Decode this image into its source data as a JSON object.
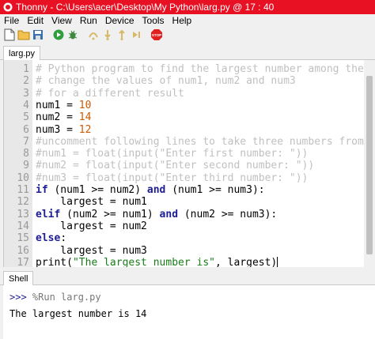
{
  "window": {
    "title": "Thonny  -  C:\\Users\\acer\\Desktop\\My Python\\larg.py  @  17 : 40",
    "accent": "#e81123"
  },
  "menu": [
    "File",
    "Edit",
    "View",
    "Run",
    "Device",
    "Tools",
    "Help"
  ],
  "toolbar": {
    "icons": [
      "new-file-icon",
      "open-file-icon",
      "save-icon",
      "run-icon",
      "debug-icon",
      "step-over-icon",
      "step-into-icon",
      "step-out-icon",
      "resume-icon",
      "stop-icon"
    ],
    "stop_label": "STOP"
  },
  "editor": {
    "tab_label": "larg.py",
    "line_numbers": [
      "1",
      "2",
      "3",
      "4",
      "5",
      "6",
      "7",
      "8",
      "9",
      "10",
      "11",
      "12",
      "13",
      "14",
      "15",
      "16",
      "17"
    ],
    "lines": {
      "l1": "# Python program to find the largest number among the three",
      "l2": "# change the values of num1, num2 and num3",
      "l3": "# for a different result",
      "l4_a": "num1 = ",
      "l4_b": "10",
      "l5_a": "num2 = ",
      "l5_b": "14",
      "l6_a": "num3 = ",
      "l6_b": "12",
      "l7": "#uncomment following lines to take three numbers from user",
      "l8": "#num1 = float(input(\"Enter first number: \"))",
      "l9": "#num2 = float(input(\"Enter second number: \"))",
      "l10": "#num3 = float(input(\"Enter third number: \"))",
      "l11_a": "if",
      "l11_b": " (num1 >= num2) ",
      "l11_c": "and",
      "l11_d": " (num1 >= num3):",
      "l12": "    largest = num1",
      "l13_a": "elif",
      "l13_b": " (num2 >= num1) ",
      "l13_c": "and",
      "l13_d": " (num2 >= num3):",
      "l14": "    largest = num2",
      "l15_a": "else",
      "l15_b": ":",
      "l16": "    largest = num3",
      "l17_a": "print(",
      "l17_b": "\"The largest number is\"",
      "l17_c": ", largest)"
    }
  },
  "shell": {
    "tab_label": "Shell",
    "prompt": ">>>",
    "command": " %Run larg.py",
    "output": "The largest number is 14"
  }
}
